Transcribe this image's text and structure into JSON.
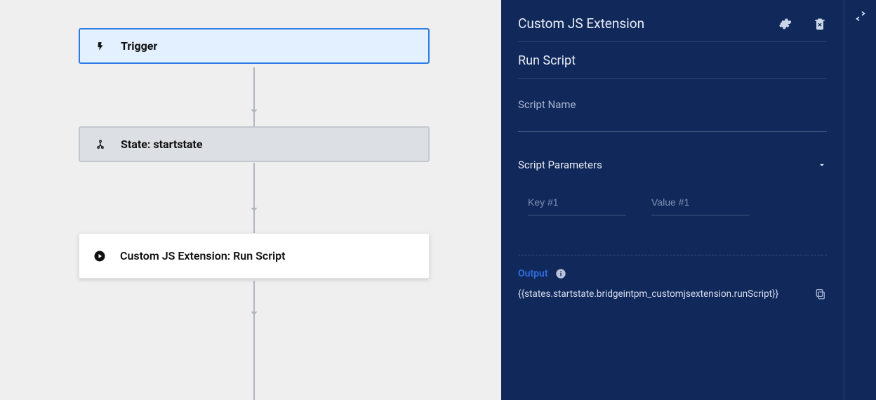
{
  "flow": {
    "nodes": [
      {
        "id": "trigger",
        "icon": "bolt-icon",
        "label": "Trigger"
      },
      {
        "id": "state",
        "icon": "tree-icon",
        "label": "State: startstate"
      },
      {
        "id": "action",
        "icon": "play-icon",
        "label": "Custom JS Extension: Run Script"
      }
    ]
  },
  "panel": {
    "title": "Custom JS Extension",
    "subtitle": "Run Script",
    "script_name_label": "Script Name",
    "script_name_value": "",
    "script_params_label": "Script Parameters",
    "params": [
      {
        "key_placeholder": "Key #1",
        "value_placeholder": "Value #1",
        "key": "",
        "value": ""
      }
    ],
    "output_label": "Output",
    "output_expr": "{{states.startstate.bridgeintpm_customjsextension.runScript}}"
  }
}
